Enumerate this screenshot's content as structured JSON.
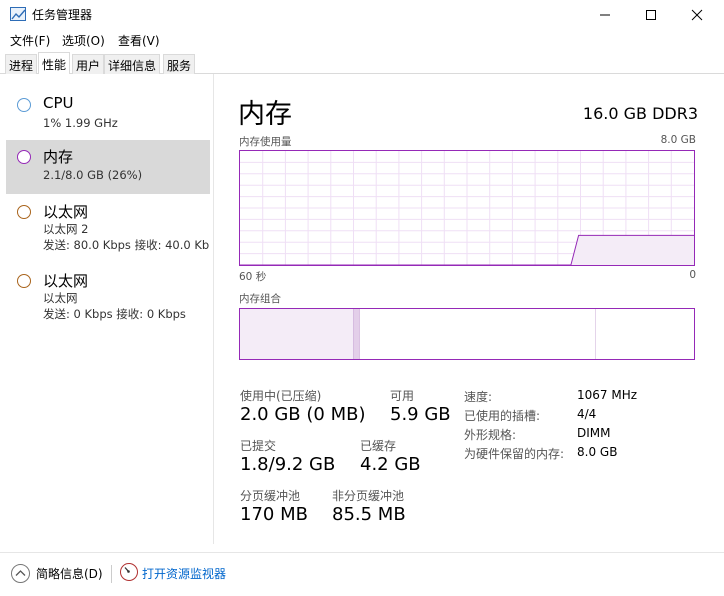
{
  "window": {
    "title": "任务管理器",
    "minimize_glyph": "—",
    "maximize_glyph": "☐",
    "close_glyph": "✕"
  },
  "menu": {
    "file": "文件(F)",
    "options": "选项(O)",
    "view": "查看(V)"
  },
  "tabs": [
    {
      "label": "进程"
    },
    {
      "label": "性能"
    },
    {
      "label": "用户"
    },
    {
      "label": "详细信息"
    },
    {
      "label": "服务"
    }
  ],
  "sidebar": {
    "items": [
      {
        "title": "CPU",
        "sub1": "1% 1.99 GHz",
        "color": "#5b9bd5"
      },
      {
        "title": "内存",
        "sub1": "2.1/8.0 GB (26%)",
        "color": "#9529b7"
      },
      {
        "title": "以太网",
        "sub1": "以太网 2",
        "sub2": "发送: 80.0 Kbps 接收: 40.0 Kb",
        "color": "#a9641c"
      },
      {
        "title": "以太网",
        "sub1": "以太网",
        "sub2": "发送: 0 Kbps 接收: 0 Kbps",
        "color": "#a9641c"
      }
    ]
  },
  "main": {
    "title": "内存",
    "total": "16.0 GB DDR3",
    "usage_label": "内存使用量",
    "usage_max": "8.0 GB",
    "axis_left": "60 秒",
    "axis_right": "0",
    "composition_label": "内存组合",
    "usage_history": [
      0,
      0,
      0,
      0,
      0,
      0,
      0,
      0,
      0,
      0,
      0,
      0,
      0,
      0,
      0,
      0,
      0,
      0,
      0,
      0,
      0,
      0,
      0,
      0,
      0,
      0,
      0,
      0,
      0,
      0,
      0,
      0,
      0,
      0,
      0,
      0,
      0,
      0,
      0,
      0,
      0,
      0,
      0,
      0,
      0.26,
      0.26,
      0.26,
      0.26,
      0.26,
      0.26,
      0.26,
      0.26,
      0.26,
      0.26,
      0.26,
      0.26,
      0.26,
      0.26,
      0.26,
      0.26
    ],
    "composition": {
      "in_use": 0.25,
      "modified": 0.014,
      "standby": 0.52,
      "free": 0.216
    },
    "accent": "#9529b7"
  },
  "stats": {
    "in_use_label": "使用中(已压缩)",
    "in_use_value": "2.0 GB (0 MB)",
    "available_label": "可用",
    "available_value": "5.9 GB",
    "committed_label": "已提交",
    "committed_value": "1.8/9.2 GB",
    "cached_label": "已缓存",
    "cached_value": "4.2 GB",
    "paged_label": "分页缓冲池",
    "paged_value": "170 MB",
    "nonpaged_label": "非分页缓冲池",
    "nonpaged_value": "85.5 MB"
  },
  "specs": [
    {
      "label": "速度:",
      "value": "1067 MHz"
    },
    {
      "label": "已使用的插槽:",
      "value": "4/4"
    },
    {
      "label": "外形规格:",
      "value": "DIMM"
    },
    {
      "label": "为硬件保留的内存:",
      "value": "8.0 GB"
    }
  ],
  "footer": {
    "fewer_details": "简略信息(D)",
    "resource_monitor": "打开资源监视器"
  }
}
